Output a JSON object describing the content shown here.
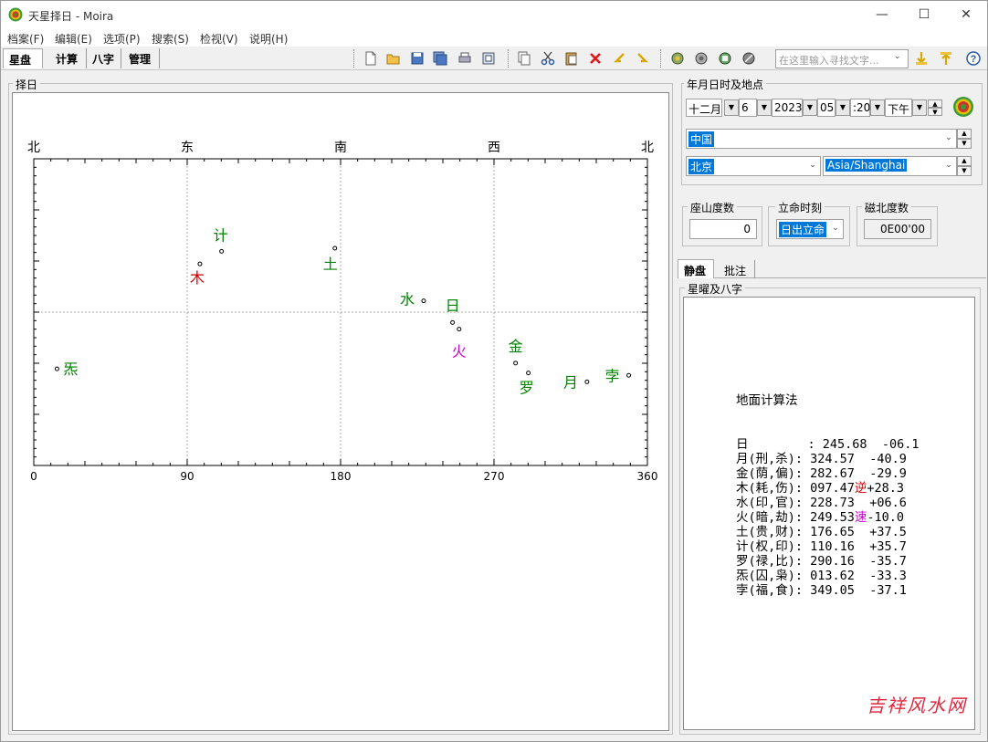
{
  "window": {
    "title": "天星择日 - Moira",
    "controls": [
      "—",
      "☐",
      "✕"
    ]
  },
  "menu": [
    "档案(F)",
    "编辑(E)",
    "选项(P)",
    "搜索(S)",
    "检视(V)",
    "说明(H)"
  ],
  "tabs": [
    "星盘",
    "计算",
    "八字",
    "管理"
  ],
  "toolbar": {
    "icons": [
      "new-file-icon",
      "open-folder-icon",
      "save-icon",
      "save-all-icon",
      "print-icon",
      "print-preview-icon",
      "copy-icon",
      "cut-icon",
      "paste-icon",
      "delete-icon",
      "undo-icon",
      "redo-icon",
      "gear-a-icon",
      "gear-b-icon",
      "gear-c-icon",
      "gear-d-icon",
      "find-icon",
      "find-next-icon",
      "help-icon"
    ],
    "search_placeholder": "在这里输入寻找文字..."
  },
  "left_panel": {
    "title": "择日"
  },
  "chart_data": {
    "type": "scatter",
    "top_labels": [
      "北",
      "东",
      "南",
      "西",
      "北"
    ],
    "x_ticks": [
      "0",
      "90",
      "180",
      "270",
      "360"
    ],
    "xlim": [
      0,
      360
    ],
    "ylim": [
      -90,
      90
    ],
    "grid": "dashed at x=90,180,270 and y=0",
    "points": [
      {
        "name": "日",
        "x": 245.68,
        "y": -6.1,
        "color": "#008000"
      },
      {
        "name": "月",
        "x": 324.57,
        "y": -40.9,
        "color": "#008000"
      },
      {
        "name": "金",
        "x": 282.67,
        "y": -29.9,
        "color": "#008000"
      },
      {
        "name": "木",
        "x": 97.47,
        "y": 28.3,
        "color": "#cc0000"
      },
      {
        "name": "水",
        "x": 228.73,
        "y": 6.6,
        "color": "#008000"
      },
      {
        "name": "火",
        "x": 249.53,
        "y": -10.0,
        "color": "#cc00cc"
      },
      {
        "name": "土",
        "x": 176.65,
        "y": 37.5,
        "color": "#008000"
      },
      {
        "name": "计",
        "x": 110.16,
        "y": 35.7,
        "color": "#008000"
      },
      {
        "name": "罗",
        "x": 290.16,
        "y": -35.7,
        "color": "#008000"
      },
      {
        "name": "炁",
        "x": 13.62,
        "y": -33.3,
        "color": "#008000"
      },
      {
        "name": "孛",
        "x": 349.05,
        "y": -37.1,
        "color": "#008000"
      }
    ]
  },
  "right_panel": {
    "datetime_group_title": "年月日时及地点",
    "month": "十二月",
    "day": "6",
    "year": "2023",
    "hour": "05",
    "minute": ":20",
    "ampm": "下午",
    "country": "中国",
    "city": "北京",
    "timezone": "Asia/Shanghai",
    "zuoshan_title": "座山度数",
    "zuoshan_value": "0",
    "liming_title": "立命时刻",
    "liming_value": "日出立命",
    "cibei_title": "磁北度数",
    "cibei_value": "0E00'00",
    "sub_tabs": [
      "静盘",
      "批注"
    ],
    "stars_group_title": "星曜及八字",
    "calc_title": "地面计算法",
    "rows": [
      {
        "label": "日        :",
        "az": "245.68",
        "flag": "",
        "alt": "-06.1"
      },
      {
        "label": "月(刑,杀):",
        "az": "324.57",
        "flag": "",
        "alt": "-40.9"
      },
      {
        "label": "金(荫,偏):",
        "az": "282.67",
        "flag": "",
        "alt": "-29.9"
      },
      {
        "label": "木(耗,伤):",
        "az": "097.47",
        "flag": "逆",
        "flag_color": "#cc0000",
        "alt": "+28.3"
      },
      {
        "label": "水(印,官):",
        "az": "228.73",
        "flag": "",
        "alt": "+06.6"
      },
      {
        "label": "火(暗,劫):",
        "az": "249.53",
        "flag": "速",
        "flag_color": "#cc00cc",
        "alt": "-10.0"
      },
      {
        "label": "土(贵,财):",
        "az": "176.65",
        "flag": "",
        "alt": "+37.5"
      },
      {
        "label": "计(权,印):",
        "az": "110.16",
        "flag": "",
        "alt": "+35.7"
      },
      {
        "label": "罗(禄,比):",
        "az": "290.16",
        "flag": "",
        "alt": "-35.7"
      },
      {
        "label": "炁(囚,枭):",
        "az": "013.62",
        "flag": "",
        "alt": "-33.3"
      },
      {
        "label": "孛(福,食):",
        "az": "349.05",
        "flag": "",
        "alt": "-37.1"
      }
    ],
    "watermark": "吉祥风水网"
  }
}
